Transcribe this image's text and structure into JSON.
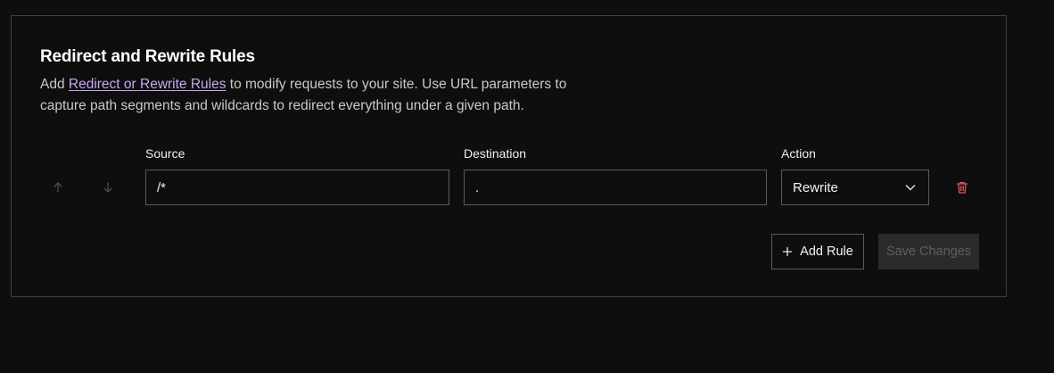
{
  "section": {
    "title": "Redirect and Rewrite Rules",
    "description_prefix": "Add ",
    "description_link": "Redirect or Rewrite Rules",
    "description_suffix": " to modify requests to your site. Use URL parameters to capture path segments and wildcards to redirect everything under a given path."
  },
  "columns": {
    "source": "Source",
    "destination": "Destination",
    "action": "Action"
  },
  "rules": [
    {
      "source": "/*",
      "destination": ".",
      "action": "Rewrite"
    }
  ],
  "buttons": {
    "add_rule": "Add Rule",
    "save_changes": "Save Changes"
  },
  "icons": {
    "move_up": "arrow-up-icon",
    "move_down": "arrow-down-icon",
    "dropdown": "chevron-down-icon",
    "delete": "trash-icon",
    "add": "plus-icon"
  },
  "colors": {
    "background": "#0e0e0e",
    "link": "#c9a6f5",
    "delete": "#e05a5a",
    "disabled_button_bg": "#2b2b2b",
    "disabled_button_text": "#5f5f5f"
  }
}
